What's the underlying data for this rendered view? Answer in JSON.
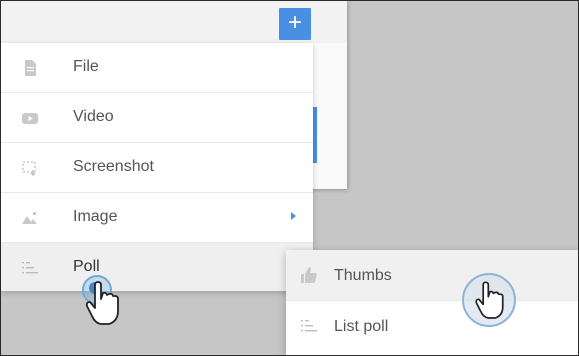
{
  "header": {
    "plus_label": "+"
  },
  "menu": {
    "items": [
      {
        "label": "File",
        "icon": "file-icon"
      },
      {
        "label": "Video",
        "icon": "video-icon"
      },
      {
        "label": "Screenshot",
        "icon": "screenshot-icon"
      },
      {
        "label": "Image",
        "icon": "image-icon",
        "has_submenu": true
      },
      {
        "label": "Poll",
        "icon": "poll-icon",
        "active": true
      }
    ]
  },
  "submenu": {
    "items": [
      {
        "label": "Thumbs",
        "icon": "thumbs-up-icon",
        "active": true
      },
      {
        "label": "List poll",
        "icon": "list-poll-icon"
      }
    ]
  },
  "colors": {
    "accent": "#4a90e2",
    "background": "#c6c6c6"
  }
}
